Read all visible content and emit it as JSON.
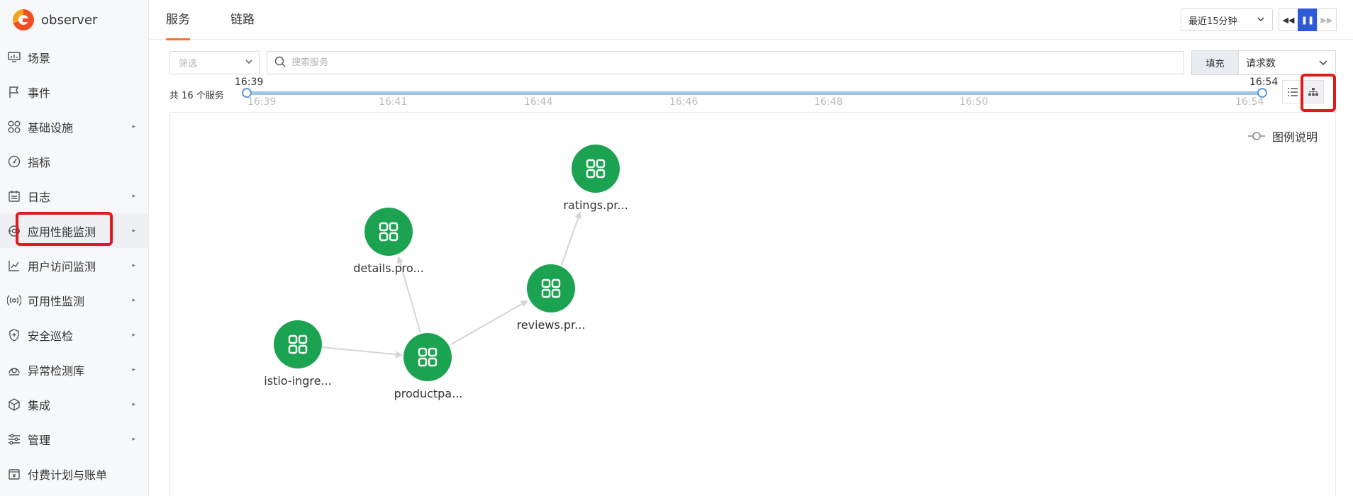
{
  "brand": {
    "name": "observer"
  },
  "sidebar": {
    "items": [
      {
        "label": "场景",
        "icon": "monitor-icon",
        "has_children": false
      },
      {
        "label": "事件",
        "icon": "flag-icon",
        "has_children": false
      },
      {
        "label": "基础设施",
        "icon": "grid-icon",
        "has_children": true
      },
      {
        "label": "指标",
        "icon": "gauge-icon",
        "has_children": false
      },
      {
        "label": "日志",
        "icon": "calendar-icon",
        "has_children": true
      },
      {
        "label": "应用性能监测",
        "icon": "apm-icon",
        "has_children": true,
        "active": true
      },
      {
        "label": "用户访问监测",
        "icon": "chart-icon",
        "has_children": true
      },
      {
        "label": "可用性监测",
        "icon": "signal-icon",
        "has_children": true
      },
      {
        "label": "安全巡检",
        "icon": "shield-icon",
        "has_children": true
      },
      {
        "label": "异常检测库",
        "icon": "radar-icon",
        "has_children": true
      },
      {
        "label": "集成",
        "icon": "cube-icon",
        "has_children": true
      },
      {
        "label": "管理",
        "icon": "sliders-icon",
        "has_children": true
      },
      {
        "label": "付费计划与账单",
        "icon": "bill-icon",
        "has_children": false
      }
    ]
  },
  "tabs": [
    {
      "label": "服务",
      "active": true
    },
    {
      "label": "链路",
      "active": false
    }
  ],
  "toolbar": {
    "time_range": "最近15分钟",
    "rewind": "◀◀",
    "pause": "❚❚",
    "forward": "▶▶"
  },
  "filter": {
    "select_placeholder": "筛选",
    "search_placeholder": "搜索服务",
    "fill_label": "填充",
    "metric": "请求数"
  },
  "timeline": {
    "count_label": "共 16 个服务",
    "start": "16:39",
    "end": "16:54",
    "ticks": [
      "16:39",
      "16:41",
      "16:44",
      "16:46",
      "16:48",
      "16:50",
      "16:54"
    ]
  },
  "legend": {
    "label": "图例说明"
  },
  "graph": {
    "nodes": [
      {
        "id": "istio",
        "label": "istio-ingre..."
      },
      {
        "id": "productpage",
        "label": "productpa..."
      },
      {
        "id": "details",
        "label": "details.pro..."
      },
      {
        "id": "reviews",
        "label": "reviews.pr..."
      },
      {
        "id": "ratings",
        "label": "ratings.pr..."
      }
    ],
    "edges": [
      {
        "from": "istio",
        "to": "productpage"
      },
      {
        "from": "productpage",
        "to": "details"
      },
      {
        "from": "productpage",
        "to": "reviews"
      },
      {
        "from": "reviews",
        "to": "ratings"
      }
    ],
    "node_color": "#1ca352"
  },
  "colors": {
    "accent": "#f7742b",
    "primary": "#2d5bd7",
    "highlight": "#e11a1a"
  }
}
